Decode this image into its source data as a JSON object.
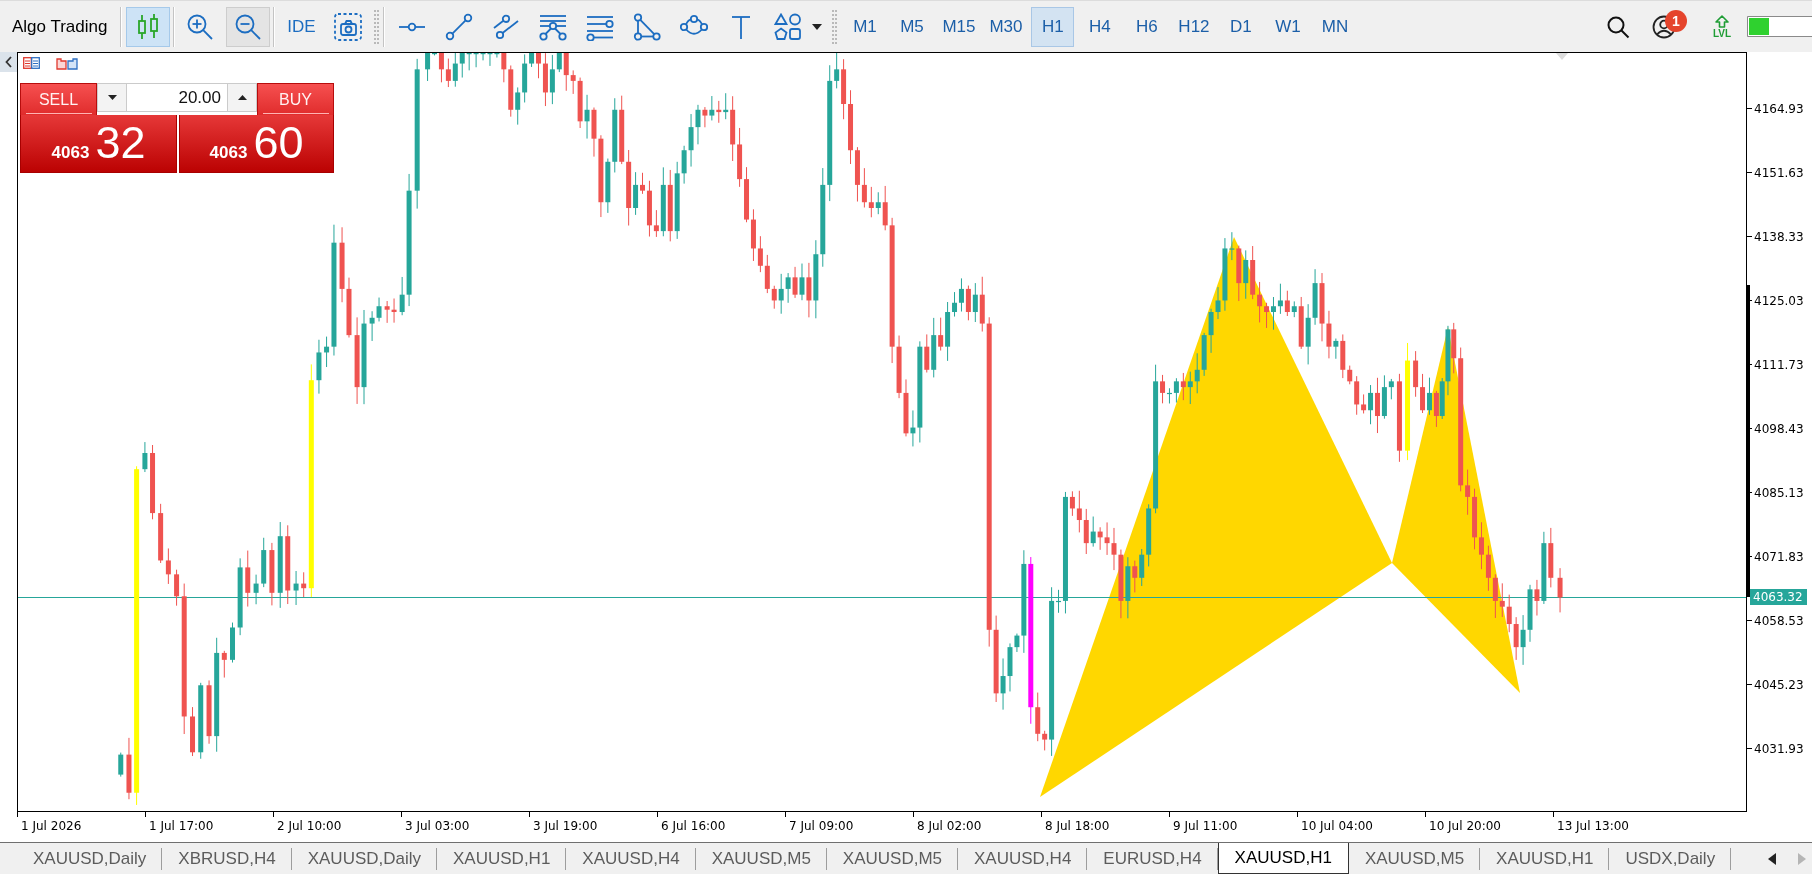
{
  "toolbar": {
    "title": "Algo Trading",
    "chart_type_button": {
      "selected": true
    },
    "zoom_out_button": {
      "hovered": true
    },
    "ide_label": "IDE",
    "timeframes": [
      {
        "label": "M1",
        "selected": false
      },
      {
        "label": "M5",
        "selected": false
      },
      {
        "label": "M15",
        "selected": false
      },
      {
        "label": "M30",
        "selected": false
      },
      {
        "label": "H1",
        "selected": true
      },
      {
        "label": "H4",
        "selected": false
      },
      {
        "label": "H6",
        "selected": false
      },
      {
        "label": "H12",
        "selected": false
      },
      {
        "label": "D1",
        "selected": false
      },
      {
        "label": "W1",
        "selected": false
      },
      {
        "label": "MN",
        "selected": false
      }
    ],
    "notification_badge": "1",
    "lvl_label": "LVL"
  },
  "trade_panel": {
    "sell": {
      "label": "SELL",
      "price_head": "4063",
      "price_tail": "32"
    },
    "volume": "20.00",
    "buy": {
      "label": "BUY",
      "price_head": "4063",
      "price_tail": "60"
    }
  },
  "price_axis": {
    "labels": [
      "4164.93",
      "4151.63",
      "4138.33",
      "4125.03",
      "4111.73",
      "4098.43",
      "4085.13",
      "4071.83",
      "4058.53",
      "4045.23",
      "4031.93"
    ],
    "current_price": "4063.32"
  },
  "time_axis": {
    "labels": [
      "1 Jul 2026",
      "1 Jul 17:00",
      "2 Jul 10:00",
      "3 Jul 03:00",
      "3 Jul 19:00",
      "6 Jul 16:00",
      "7 Jul 09:00",
      "8 Jul 02:00",
      "8 Jul 18:00",
      "9 Jul 11:00",
      "10 Jul 04:00",
      "10 Jul 20:00",
      "13 Jul 13:00"
    ]
  },
  "tabs": [
    {
      "label": "XAUUSD,Daily",
      "selected": false
    },
    {
      "label": "XBRUSD,H4",
      "selected": false
    },
    {
      "label": "XAUUSD,Daily",
      "selected": false
    },
    {
      "label": "XAUUSD,H1",
      "selected": false
    },
    {
      "label": "XAUUSD,H4",
      "selected": false
    },
    {
      "label": "XAUUSD,M5",
      "selected": false
    },
    {
      "label": "XAUUSD,M5",
      "selected": false
    },
    {
      "label": "XAUUSD,H4",
      "selected": false
    },
    {
      "label": "EURUSD,H4",
      "selected": false
    },
    {
      "label": "XAUUSD,H1",
      "selected": true
    },
    {
      "label": "XAUUSD,M5",
      "selected": false
    },
    {
      "label": "XAUUSD,H1",
      "selected": false
    },
    {
      "label": "USDX,Daily",
      "selected": false
    }
  ],
  "tab_scroll": {
    "left": {
      "disabled": false
    },
    "right": {
      "disabled": true
    }
  }
}
